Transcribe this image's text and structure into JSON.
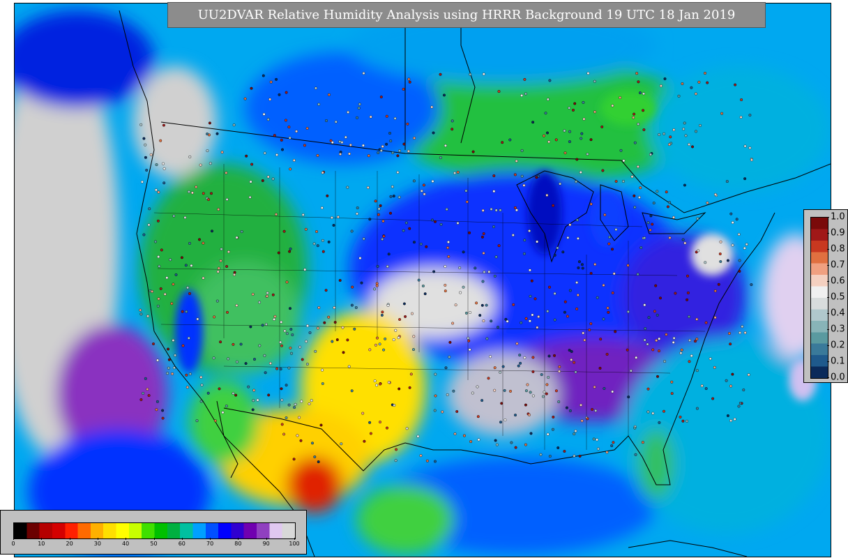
{
  "title": "UU2DVAR Relative Humidity Analysis using HRRR Background 19 UTC 18 Jan 2019",
  "rh_colorbar": {
    "min": 0,
    "max": 100,
    "ticks": [
      "0",
      "10",
      "20",
      "30",
      "40",
      "50",
      "60",
      "70",
      "80",
      "90",
      "100"
    ],
    "colors": [
      "#000000",
      "#6b0000",
      "#b50000",
      "#d40000",
      "#ff2000",
      "#ff6a00",
      "#ffb000",
      "#ffdf00",
      "#ffff00",
      "#c8ff00",
      "#40e000",
      "#00c000",
      "#00b040",
      "#00c0a0",
      "#00a0ff",
      "#0050ff",
      "#0000ff",
      "#3000d0",
      "#7000b0",
      "#9040c0",
      "#e0c8f0",
      "#d8d8d8"
    ]
  },
  "ratio_colorbar": {
    "min": 0.0,
    "max": 1.0,
    "ticks": [
      "1.0",
      "0.9",
      "0.8",
      "0.7",
      "0.6",
      "0.5",
      "0.4",
      "0.3",
      "0.2",
      "0.1",
      "0.0"
    ],
    "colors": [
      "#0a2a5a",
      "#1f5a8c",
      "#3a7a9a",
      "#5a9aa0",
      "#88b4b8",
      "#b0c8cc",
      "#d8dcdc",
      "#f0f0f0",
      "#f4d0c0",
      "#f0a080",
      "#e07040",
      "#c83820",
      "#a01818",
      "#7a0a0a"
    ]
  },
  "map_colors": {
    "ocean_humid": "#0000e0",
    "ocean_mid": "#00a0ff",
    "saturated": "#d0d0d0",
    "dry_land": "#ffd000",
    "moderate_land": "#00c000"
  }
}
